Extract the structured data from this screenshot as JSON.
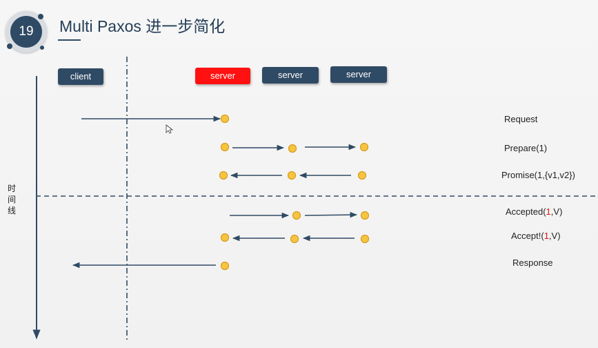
{
  "slide": {
    "number": "19",
    "title": "Multi Paxos 进一步简化"
  },
  "nodes": {
    "client": "client",
    "server1": "server",
    "server2": "server",
    "server3": "server"
  },
  "axis_label": "时间线",
  "messages": {
    "request": "Request",
    "prepare": "Prepare(1)",
    "promise": "Promise(1,{v1,v2})",
    "accepted_prefix": "Accepted(",
    "accepted_number": "1",
    "accepted_suffix": ",V)",
    "accept_prefix": "Accept!(",
    "accept_number": "1",
    "accept_suffix": ",V)",
    "response": "Response"
  },
  "colors": {
    "dark_node": "#2f4a64",
    "leader_node": "#ff1111",
    "dot_fill": "#f5c542",
    "dot_stroke": "#d99a1b",
    "arrow": "#2f4a64",
    "highlight": "#e01010"
  },
  "icons": {
    "cursor": "mouse-pointer-icon"
  }
}
